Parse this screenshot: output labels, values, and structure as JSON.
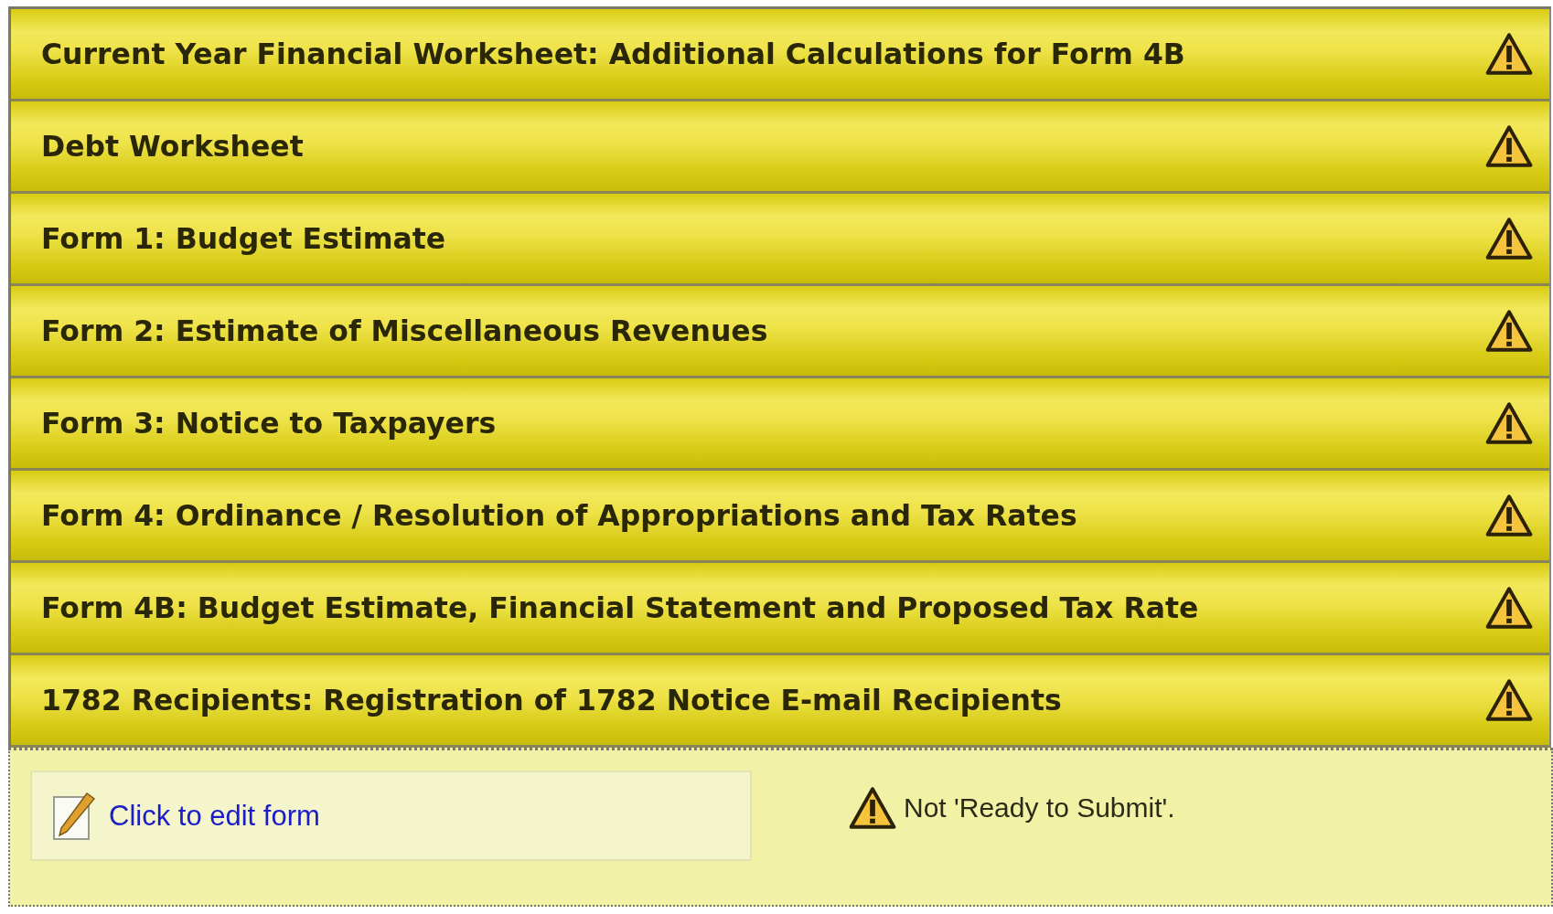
{
  "forms": [
    {
      "title": "Current Year Financial Worksheet: Additional Calculations for Form 4B",
      "warning": true
    },
    {
      "title": "Debt Worksheet",
      "warning": true
    },
    {
      "title": "Form 1: Budget Estimate",
      "warning": true
    },
    {
      "title": "Form 2: Estimate of Miscellaneous Revenues",
      "warning": true
    },
    {
      "title": "Form 3: Notice to Taxpayers",
      "warning": true
    },
    {
      "title": "Form 4: Ordinance / Resolution of Appropriations and Tax Rates",
      "warning": true
    },
    {
      "title": "Form 4B: Budget Estimate, Financial Statement and Proposed Tax Rate",
      "warning": true
    },
    {
      "title": "1782 Recipients: Registration of 1782 Notice E-mail Recipients",
      "warning": true
    }
  ],
  "detail": {
    "edit_link": "Click to edit form",
    "status": "Not 'Ready to Submit'.",
    "warning": true
  }
}
